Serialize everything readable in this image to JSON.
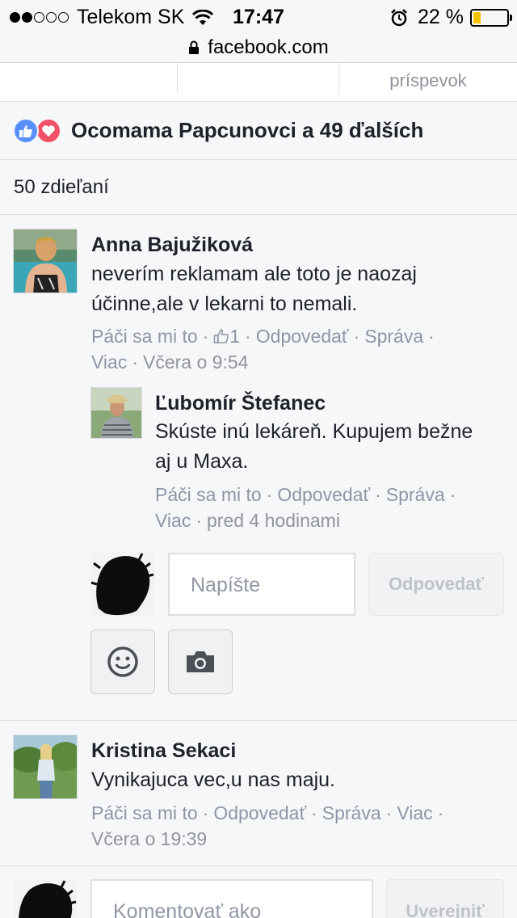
{
  "status_bar": {
    "carrier": "Telekom SK",
    "time": "17:47",
    "battery_percent": "22 %",
    "battery_level": 0.22
  },
  "browser": {
    "url": "facebook.com"
  },
  "post_actions": {
    "share_label": "príspevok"
  },
  "reactions": {
    "text": "Ocomama Papcunovci a 49 ďalších"
  },
  "shares": {
    "text": "50 zdieľaní"
  },
  "comments": [
    {
      "author": "Anna Bajužiková",
      "text": "neverím reklamam ale toto je naozaj účinne,ale v lekarni to nemali.",
      "like": "Páči sa mi to",
      "like_count": "1",
      "reply": "Odpovedať",
      "message": "Správa",
      "more": "Viac",
      "time": "Včera o 9:54"
    },
    {
      "author": "Kristina Sekaci",
      "text": "Vynikajuca vec,u nas maju.",
      "like": "Páči sa mi to",
      "reply": "Odpovedať",
      "message": "Správa",
      "more": "Viac",
      "time": "Včera o 19:39"
    }
  ],
  "reply": {
    "author": "Ľubomír Štefanec",
    "text": "Skúste inú lekáreň. Kupujem bežne aj u Maxa.",
    "like": "Páči sa mi to",
    "reply": "Odpovedať",
    "message": "Správa",
    "more": "Viac",
    "time": "pred 4 hodinami"
  },
  "reply_composer": {
    "placeholder": "Napíšte",
    "submit_label": "Odpovedať"
  },
  "comment_composer": {
    "placeholder": "Komentovať ako",
    "submit_label": "Uverejniť"
  },
  "colors": {
    "link": "#8d96a6",
    "like_blue": "#5890ff",
    "love_red": "#f25268",
    "battery_fill": "#f4c300"
  }
}
